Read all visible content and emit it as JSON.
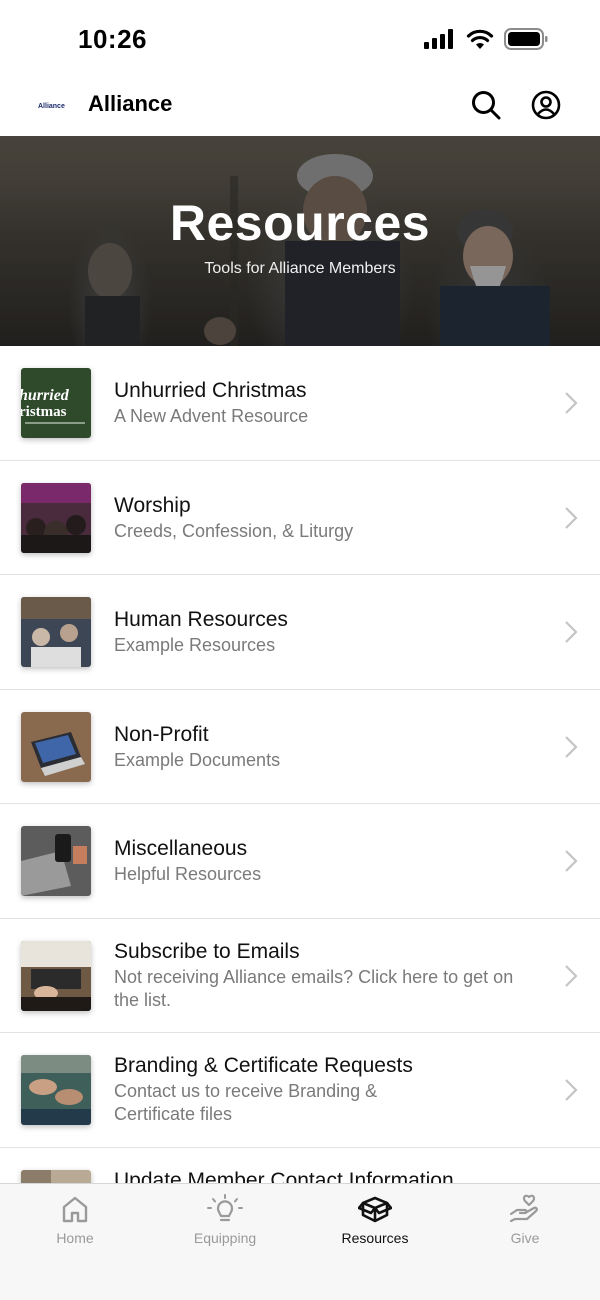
{
  "status_bar": {
    "time": "10:26"
  },
  "header": {
    "logo_text": "Alliance",
    "title": "Alliance"
  },
  "hero": {
    "title": "Resources",
    "subtitle": "Tools for Alliance Members"
  },
  "items": [
    {
      "title": "Unhurried Christmas",
      "subtitle": "A New Advent Resource",
      "thumb_text": "hurried\nristmas",
      "thumb_color": "#2e4a2b"
    },
    {
      "title": "Worship",
      "subtitle": "Creeds, Confession, & Liturgy",
      "thumb_color": "#4a2b3d"
    },
    {
      "title": "Human Resources",
      "subtitle": "Example Resources",
      "thumb_color": "#3d4654"
    },
    {
      "title": "Non-Profit",
      "subtitle": "Example Documents",
      "thumb_color": "#8a6a4e"
    },
    {
      "title": "Miscellaneous",
      "subtitle": "Helpful Resources",
      "thumb_color": "#5c5c5c"
    },
    {
      "title": "Subscribe to Emails",
      "subtitle": "Not receiving Alliance emails? Click here to get on the list.",
      "thumb_color": "#6e5a44"
    },
    {
      "title": "Branding & Certificate Requests",
      "subtitle": "Contact us to receive Branding & Certificate files",
      "thumb_color": "#3f5f5a"
    },
    {
      "title": "Update Member Contact Information",
      "subtitle": "",
      "thumb_color": "#b9aa95"
    }
  ],
  "tabs": [
    {
      "label": "Home",
      "icon": "home-icon",
      "active": false
    },
    {
      "label": "Equipping",
      "icon": "lightbulb-icon",
      "active": false
    },
    {
      "label": "Resources",
      "icon": "box-icon",
      "active": true
    },
    {
      "label": "Give",
      "icon": "give-icon",
      "active": false
    }
  ],
  "colors": {
    "accent": "#111111",
    "inactive": "#9a9a9a",
    "divider": "#e2e2e2"
  }
}
